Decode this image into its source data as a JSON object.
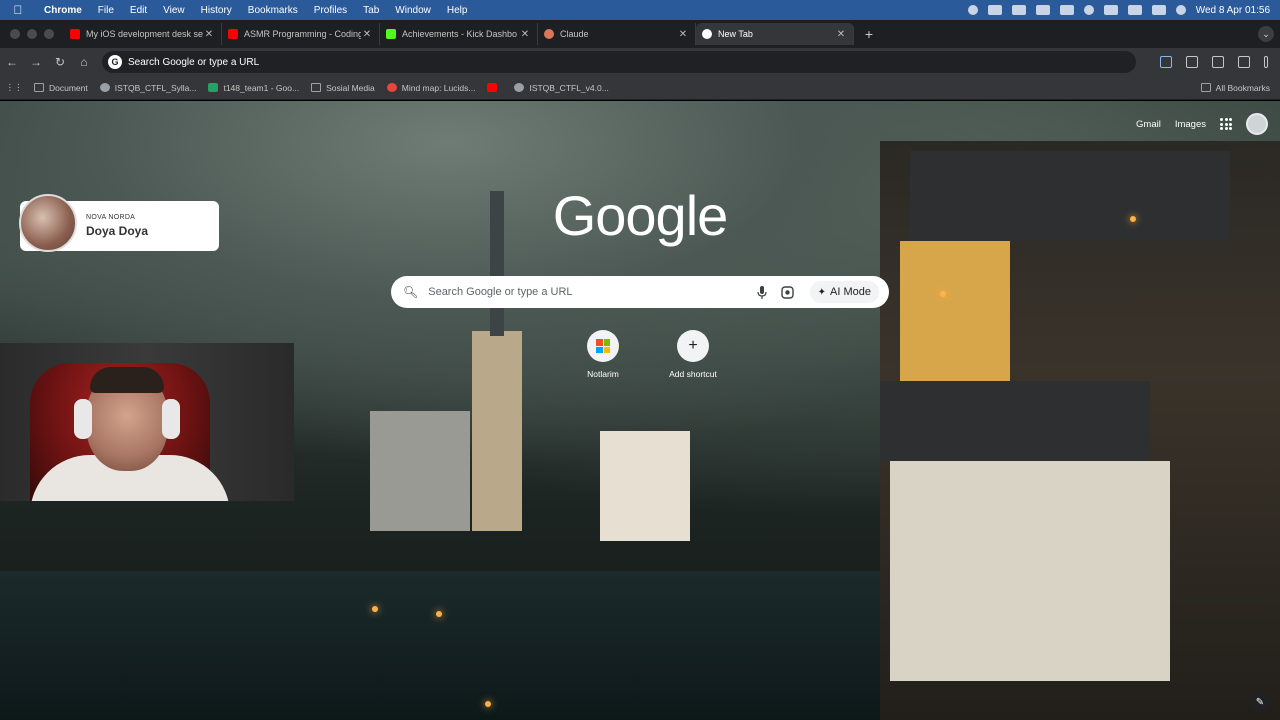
{
  "menubar": {
    "app": "Chrome",
    "items": [
      "File",
      "Edit",
      "View",
      "History",
      "Bookmarks",
      "Profiles",
      "Tab",
      "Window",
      "Help"
    ],
    "clock": "Wed 8 Apr  01:56"
  },
  "tabs": [
    {
      "label": "My iOS development desk se",
      "favicon_color": "#ff0000",
      "icon": "youtube-icon"
    },
    {
      "label": "ASMR Programming - Coding",
      "favicon_color": "#ff0000",
      "icon": "youtube-icon"
    },
    {
      "label": "Achievements - Kick Dashbo",
      "favicon_color": "#53fc18",
      "icon": "kick-icon"
    },
    {
      "label": "Claude",
      "favicon_color": "#d97757",
      "icon": "claude-icon"
    },
    {
      "label": "New Tab",
      "favicon_color": "#ffffff",
      "icon": "chrome-icon",
      "active": true
    }
  ],
  "omnibox": {
    "placeholder": "Search Google or type a URL"
  },
  "bookmarks": [
    {
      "label": "Document",
      "type": "folder"
    },
    {
      "label": "ISTQB_CTFL_Sylla...",
      "type": "link",
      "color": "#9aa0a6"
    },
    {
      "label": "t148_team1 - Goo...",
      "type": "link",
      "color": "#1fa463"
    },
    {
      "label": "Sosial Media",
      "type": "folder"
    },
    {
      "label": "Mind map: Lucids...",
      "type": "link",
      "color": "#e8453c"
    },
    {
      "label": "",
      "type": "link",
      "color": "#ff0000"
    },
    {
      "label": "ISTQB_CTFL_v4.0...",
      "type": "link",
      "color": "#9aa0a6"
    }
  ],
  "all_bookmarks": "All Bookmarks",
  "google": {
    "gmail": "Gmail",
    "images": "Images",
    "logo": "Google",
    "search_placeholder": "Search Google or type a URL",
    "ai_mode": "AI Mode",
    "shortcuts": [
      {
        "label": "Notlarim",
        "icon": "microsoft-icon"
      },
      {
        "label": "Add shortcut",
        "icon": "plus-icon"
      }
    ]
  },
  "overlay": {
    "small_label": "NOVA NORDA",
    "name": "Doya Doya"
  },
  "colors": {
    "menubar": "#2a5a9a",
    "tabstrip": "#1e1f22",
    "toolbar": "#35363a"
  }
}
